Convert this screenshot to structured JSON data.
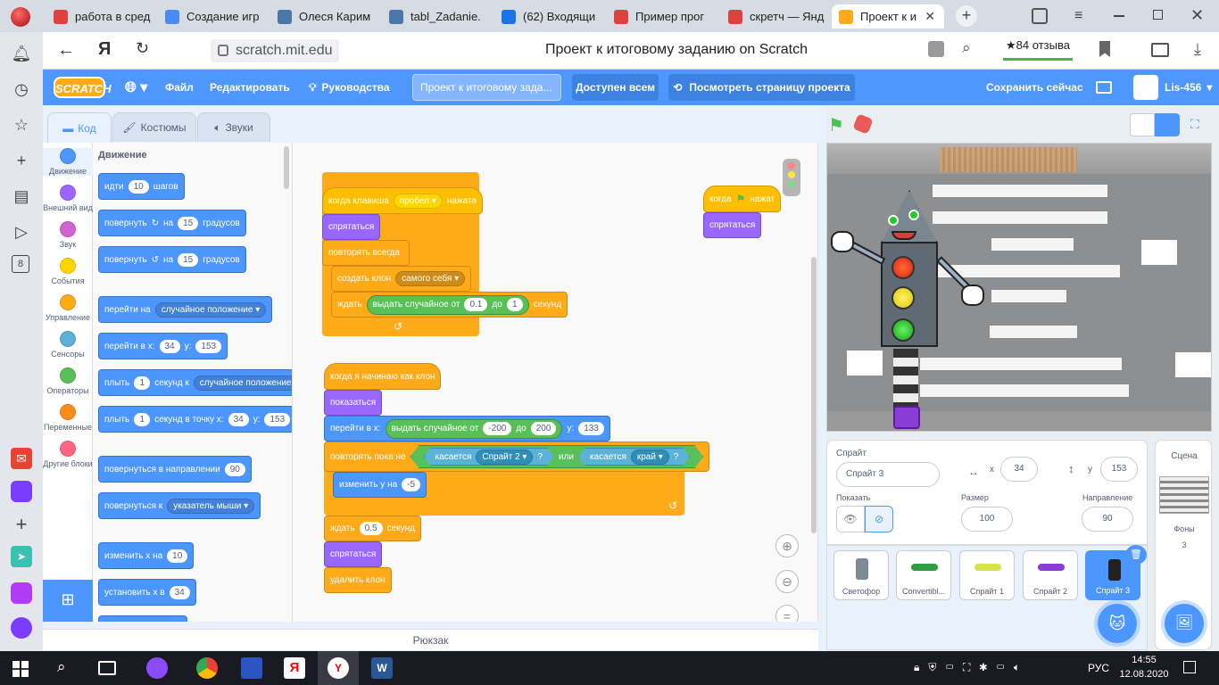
{
  "browser": {
    "tabs": [
      {
        "label": "работа в сред",
        "color": "#e04040"
      },
      {
        "label": "Создание игр",
        "color": "#4a8af4"
      },
      {
        "label": "Олеся Карим",
        "color": "#4a76a8"
      },
      {
        "label": "tabl_Zadanie.",
        "color": "#4a76a8"
      },
      {
        "label": "(62) Входящи",
        "color": "#1a73e8"
      },
      {
        "label": "Пример прог",
        "color": "#e04040"
      },
      {
        "label": "скретч — Янд",
        "color": "#e04040"
      },
      {
        "label": "Проект к и",
        "color": "#ffab19"
      }
    ],
    "url": "scratch.mit.edu",
    "page_title": "Проект к итоговому заданию on Scratch",
    "reviews": "★84 отзыва"
  },
  "menu": {
    "logo": "SCRATCH",
    "file": "Файл",
    "edit": "Редактировать",
    "tutorials": "Руководства",
    "project_title": "Проект к итоговому зада...",
    "share": "Доступен всем",
    "see_page": "Посмотреть страницу проекта",
    "save": "Сохранить сейчас",
    "user": "Lis-456"
  },
  "editor_tabs": {
    "code": "Код",
    "costumes": "Костюмы",
    "sounds": "Звуки"
  },
  "categories": [
    {
      "label": "Движение",
      "color": "#4c97ff"
    },
    {
      "label": "Внешний вид",
      "color": "#9966ff"
    },
    {
      "label": "Звук",
      "color": "#cf63cf"
    },
    {
      "label": "События",
      "color": "#ffd500"
    },
    {
      "label": "Управление",
      "color": "#ffab19"
    },
    {
      "label": "Сенсоры",
      "color": "#5cb1d6"
    },
    {
      "label": "Операторы",
      "color": "#59c059"
    },
    {
      "label": "Переменные",
      "color": "#ff8c1a"
    },
    {
      "label": "Другие блоки",
      "color": "#ff6680"
    }
  ],
  "palette": {
    "heading": "Движение",
    "move": {
      "a": "идти",
      "n": "10",
      "b": "шагов"
    },
    "turn_r": {
      "a": "повернуть",
      "b": "на",
      "n": "15",
      "c": "градусов"
    },
    "turn_l": {
      "a": "повернуть",
      "b": "на",
      "n": "15",
      "c": "градусов"
    },
    "goto": {
      "a": "перейти на",
      "d": "случайное положение"
    },
    "goto_xy": {
      "a": "перейти в x:",
      "x": "34",
      "b": "y:",
      "y": "153"
    },
    "glide": {
      "a": "плыть",
      "n": "1",
      "b": "секунд к",
      "d": "случайное положение"
    },
    "glide_xy": {
      "a": "плыть",
      "n": "1",
      "b": "секунд в точку x:",
      "x": "34",
      "c": "y:",
      "y": "153"
    },
    "point_dir": {
      "a": "повернуться в направлении",
      "n": "90"
    },
    "point_to": {
      "a": "повернуться к",
      "d": "указатель мыши"
    },
    "change_x": {
      "a": "изменить x на",
      "n": "10"
    },
    "set_x": {
      "a": "установить x в",
      "n": "34"
    }
  },
  "scripts": {
    "s1": {
      "hat_a": "когда клавиша",
      "key": "пробел",
      "hat_b": "нажата",
      "hide": "спрятаться",
      "forever": "повторять всегда",
      "clone": "создать клон",
      "clone_of": "самого себя",
      "wait": "ждать",
      "rand": "выдать случайное от",
      "from": "0.1",
      "to_word": "до",
      "to": "1",
      "sec": "секунд"
    },
    "s2": {
      "hat": "когда я начинаю как клон",
      "show": "показаться",
      "goto": "перейти в x:",
      "rand": "выдать случайное от",
      "from": "-200",
      "to_word": "до",
      "to": "200",
      "y": "y:",
      "yv": "133",
      "until": "повторять пока не",
      "touch": "касается",
      "sprite": "Спрайт 2",
      "q": "?",
      "or": "или",
      "touch2": "касается",
      "edge": "край",
      "change": "изменить y на",
      "cv": "-5",
      "wait": "ждать",
      "wv": "0.5",
      "sec": "секунд",
      "hide": "спрятаться",
      "del": "удалить клон"
    },
    "s3": {
      "hat_a": "когда",
      "hat_b": "нажат",
      "hide": "спрятаться"
    }
  },
  "backpack": "Рюкзак",
  "sprite_info": {
    "label": "Спрайт",
    "name": "Спрайт 3",
    "x_label": "x",
    "x": "34",
    "y_label": "y",
    "y": "153",
    "show_label": "Показать",
    "size_label": "Размер",
    "size": "100",
    "dir_label": "Направление",
    "dir": "90"
  },
  "sprites": [
    {
      "name": "Светофор"
    },
    {
      "name": "Convertibl..."
    },
    {
      "name": "Спрайт 1"
    },
    {
      "name": "Спрайт 2"
    },
    {
      "name": "Спрайт 3"
    }
  ],
  "stage_panel": {
    "title": "Сцена",
    "backdrops": "Фоны",
    "count": "3"
  },
  "taskbar": {
    "lang": "РУС",
    "time": "14:55",
    "date": "12.08.2020"
  }
}
